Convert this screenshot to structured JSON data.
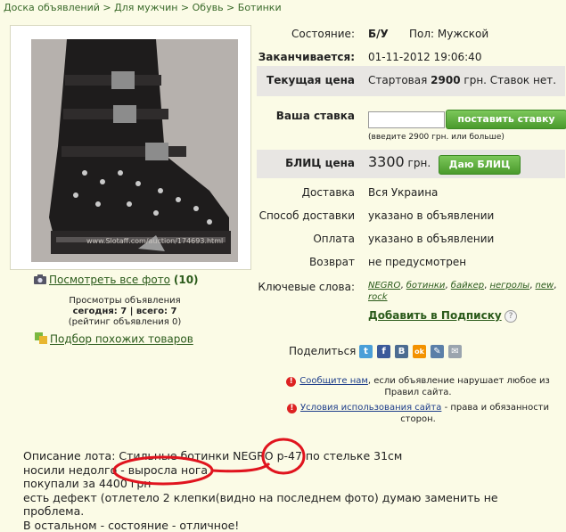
{
  "breadcrumb": "Доска объявлений > Для мужчин > Обувь > Ботинки",
  "photo": {
    "watermark": "www.Slotaff.com/auction/174693.html"
  },
  "view_all": {
    "label": "Посмотреть все фото",
    "count": "(10)"
  },
  "stats": {
    "line1": "Просмотры объявления",
    "line2": "сегодня: 7 | всего: 7",
    "line3": "(рейтинг объявления 0)"
  },
  "similar": {
    "label": "Подбор похожих товаров"
  },
  "table": {
    "condition_label": "Состояние:",
    "condition_value": "Б/У",
    "gender_text": "Пол: Мужской",
    "ends_label": "Заканчивается:",
    "ends_value": "01-11-2012 19:06:40",
    "price_label": "Текущая цена",
    "price_prefix": "Стартовая",
    "price_value": "2900",
    "price_suffix": "грн. Ставок нет.",
    "bid_label": "Ваша ставка",
    "bid_button": "поставить ставку",
    "bid_hint": "(введите 2900 грн. или больше)",
    "blitz_label": "БЛИЦ цена",
    "blitz_value": "3300",
    "blitz_currency": "грн.",
    "blitz_button": "Даю БЛИЦ",
    "delivery_label": "Доставка",
    "delivery_value": "Вся Украина",
    "method_label": "Способ доставки",
    "method_value": "указано в объявлении",
    "payment_label": "Оплата",
    "payment_value": "указано в объявлении",
    "return_label": "Возврат",
    "return_value": "не предусмотрен",
    "keywords_label": "Ключевые слова:",
    "keywords": [
      "NEGRO",
      "ботинки",
      "байкер",
      "негролы",
      "new",
      "rock"
    ],
    "subscribe": "Добавить в Подписку",
    "help": "?"
  },
  "share": {
    "label": "Поделиться",
    "icons": [
      {
        "name": "twitter-icon",
        "char": "t",
        "color": "#4a9fd8"
      },
      {
        "name": "facebook-icon",
        "char": "f",
        "color": "#3b5a9a"
      },
      {
        "name": "vkontakte-icon",
        "char": "B",
        "color": "#4c6c91"
      },
      {
        "name": "odnoklassniki-icon",
        "char": "ok",
        "color": "#f39200"
      },
      {
        "name": "livejournal-icon",
        "char": "✎",
        "color": "#5b7fa8"
      },
      {
        "name": "email-icon",
        "char": "✉",
        "color": "#9aa4ae"
      }
    ]
  },
  "report": {
    "link1": "Сообщите нам",
    "text1": ", если объявление нарушает любое из",
    "text1b": "Правил сайта.",
    "link2": "Условия использования сайта",
    "text2": " - права и обязанности",
    "text2b": "сторон."
  },
  "description": {
    "line1": "Описание лота: Стильные ботинки NEGRO р-47 по стельке 31см",
    "line2": "носили недолго - выросла нога",
    "line3": "покупали за 4400 грн",
    "line4": "есть дефект (отлетело 2 клепки(видно на последнем фото) думаю заменить не проблема.",
    "line5": "В остальном - состояние - отличное!"
  },
  "colors": {
    "accent": "#4a9a2c",
    "annotation": "#e0141e",
    "background": "#fbfbe6"
  }
}
